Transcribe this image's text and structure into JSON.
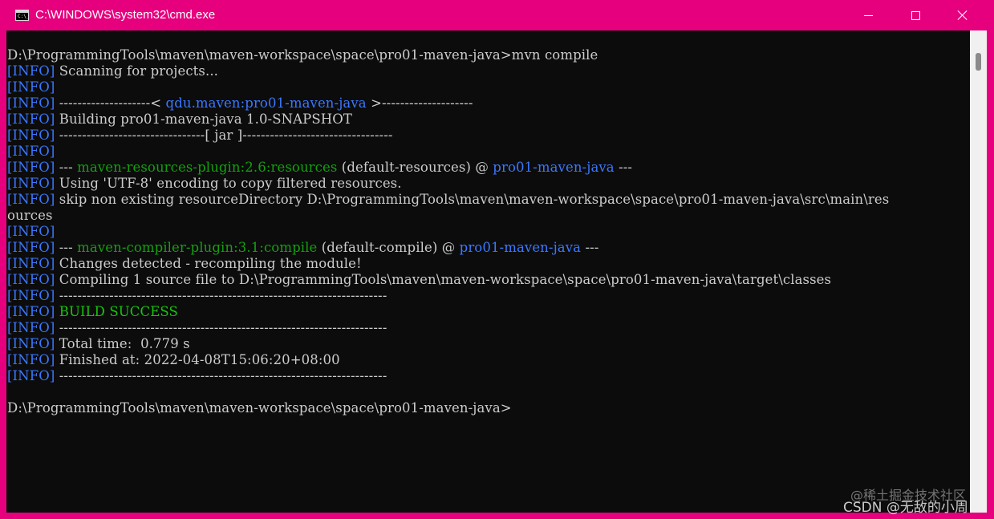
{
  "window": {
    "title": "C:\\WINDOWS\\system32\\cmd.exe",
    "icon_text": "C:\\_",
    "accent_color": "#e6007e",
    "console_bg": "#0c0c0c",
    "controls": {
      "minimize_icon": "minimize-icon",
      "maximize_icon": "maximize-icon",
      "close_icon": "close-icon"
    }
  },
  "console": {
    "lines": [
      [
        {
          "t": "D:\\ProgrammingTools\\maven\\maven-workspace\\space\\pro01-maven-java>mvn compile",
          "c": ""
        }
      ],
      [
        {
          "t": "[INFO]",
          "c": "info"
        },
        {
          "t": " Scanning for projects...",
          "c": ""
        }
      ],
      [
        {
          "t": "[INFO]",
          "c": "info"
        }
      ],
      [
        {
          "t": "[INFO]",
          "c": "info"
        },
        {
          "t": " --------------------< ",
          "c": ""
        },
        {
          "t": "qdu.maven:pro01-maven-java",
          "c": "blue"
        },
        {
          "t": " >--------------------",
          "c": ""
        }
      ],
      [
        {
          "t": "[INFO]",
          "c": "info"
        },
        {
          "t": " Building pro01-maven-java 1.0-SNAPSHOT",
          "c": ""
        }
      ],
      [
        {
          "t": "[INFO]",
          "c": "info"
        },
        {
          "t": " --------------------------------[ jar ]---------------------------------",
          "c": ""
        }
      ],
      [
        {
          "t": "[INFO]",
          "c": "info"
        }
      ],
      [
        {
          "t": "[INFO]",
          "c": "info"
        },
        {
          "t": " --- ",
          "c": ""
        },
        {
          "t": "maven-resources-plugin:2.6:resources",
          "c": "green"
        },
        {
          "t": " (default-resources) @ ",
          "c": ""
        },
        {
          "t": "pro01-maven-java",
          "c": "blue"
        },
        {
          "t": " ---",
          "c": ""
        }
      ],
      [
        {
          "t": "[INFO]",
          "c": "info"
        },
        {
          "t": " Using 'UTF-8' encoding to copy filtered resources.",
          "c": ""
        }
      ],
      [
        {
          "t": "[INFO]",
          "c": "info"
        },
        {
          "t": " skip non existing resourceDirectory D:\\ProgrammingTools\\maven\\maven-workspace\\space\\pro01-maven-java\\src\\main\\res",
          "c": ""
        }
      ],
      [
        {
          "t": "ources",
          "c": ""
        }
      ],
      [
        {
          "t": "[INFO]",
          "c": "info"
        }
      ],
      [
        {
          "t": "[INFO]",
          "c": "info"
        },
        {
          "t": " --- ",
          "c": ""
        },
        {
          "t": "maven-compiler-plugin:3.1:compile",
          "c": "green"
        },
        {
          "t": " (default-compile) @ ",
          "c": ""
        },
        {
          "t": "pro01-maven-java",
          "c": "blue"
        },
        {
          "t": " ---",
          "c": ""
        }
      ],
      [
        {
          "t": "[INFO]",
          "c": "info"
        },
        {
          "t": " Changes detected - recompiling the module!",
          "c": ""
        }
      ],
      [
        {
          "t": "[INFO]",
          "c": "info"
        },
        {
          "t": " Compiling 1 source file to D:\\ProgrammingTools\\maven\\maven-workspace\\space\\pro01-maven-java\\target\\classes",
          "c": ""
        }
      ],
      [
        {
          "t": "[INFO]",
          "c": "info"
        },
        {
          "t": " ------------------------------------------------------------------------",
          "c": ""
        }
      ],
      [
        {
          "t": "[INFO]",
          "c": "info"
        },
        {
          "t": " ",
          "c": ""
        },
        {
          "t": "BUILD SUCCESS",
          "c": "bgreen"
        }
      ],
      [
        {
          "t": "[INFO]",
          "c": "info"
        },
        {
          "t": " ------------------------------------------------------------------------",
          "c": ""
        }
      ],
      [
        {
          "t": "[INFO]",
          "c": "info"
        },
        {
          "t": " Total time:  0.779 s",
          "c": ""
        }
      ],
      [
        {
          "t": "[INFO]",
          "c": "info"
        },
        {
          "t": " Finished at: 2022-04-08T15:06:20+08:00",
          "c": ""
        }
      ],
      [
        {
          "t": "[INFO]",
          "c": "info"
        },
        {
          "t": " ------------------------------------------------------------------------",
          "c": ""
        }
      ],
      [],
      [
        {
          "t": "D:\\ProgrammingTools\\maven\\maven-workspace\\space\\pro01-maven-java>",
          "c": ""
        }
      ]
    ],
    "colors": {
      "text": "#cccccc",
      "info": "#3b78ff",
      "plugin": "#13a10e",
      "success": "#16c60c"
    }
  },
  "watermark": {
    "line1": "@稀土掘金技术社区",
    "line2": "CSDN @无敌的小周"
  }
}
